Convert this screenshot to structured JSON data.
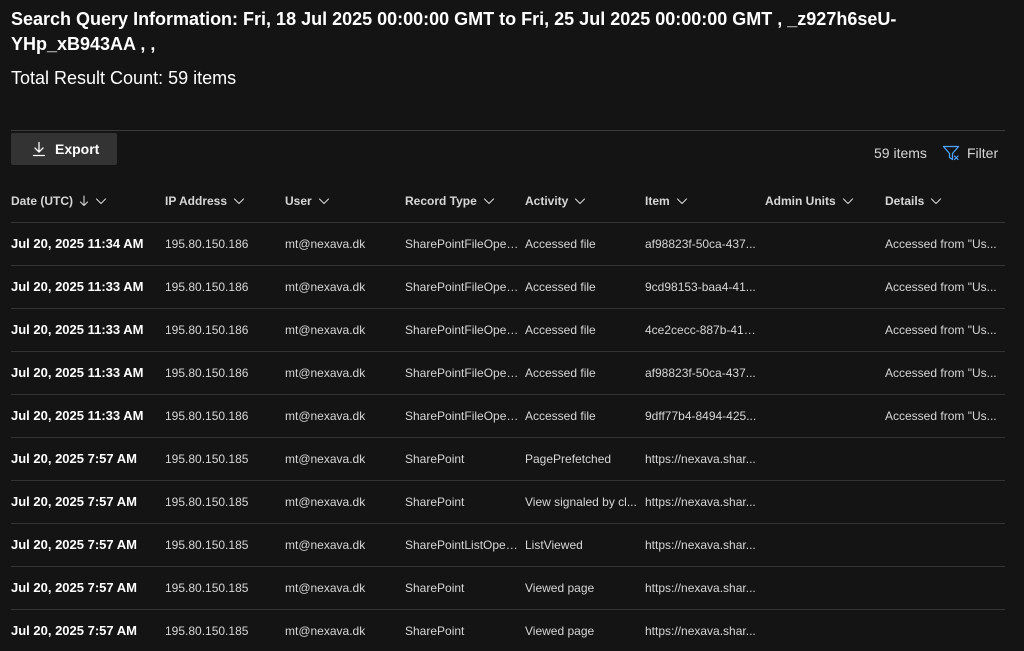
{
  "header": {
    "title": "Search Query Information: Fri, 18 Jul 2025 00:00:00 GMT to Fri, 25 Jul 2025 00:00:00 GMT , _z927h6seU-YHp_xB943AA , ,",
    "total_result": "Total Result Count: 59 items"
  },
  "toolbar": {
    "export_label": "Export",
    "items_count": "59 items",
    "filter_label": "Filter"
  },
  "icons": {
    "export": "download-icon",
    "filter": "filter-icon",
    "sort": "arrow-down-icon",
    "column_menu": "chevron-down-icon"
  },
  "colors": {
    "background": "#141414",
    "accent": "#4da3ff",
    "button_bg": "#333333",
    "divider": "#333333"
  },
  "table": {
    "columns": [
      {
        "key": "date",
        "label": "Date (UTC)",
        "sorted": "descending"
      },
      {
        "key": "ip",
        "label": "IP Address"
      },
      {
        "key": "user",
        "label": "User"
      },
      {
        "key": "record_type",
        "label": "Record Type"
      },
      {
        "key": "activity",
        "label": "Activity"
      },
      {
        "key": "item",
        "label": "Item"
      },
      {
        "key": "admin_units",
        "label": "Admin Units"
      },
      {
        "key": "details",
        "label": "Details"
      }
    ],
    "rows": [
      {
        "date": "Jul 20, 2025 11:34 AM",
        "ip": "195.80.150.186",
        "user": "mt@nexava.dk",
        "record_type": "SharePointFileOper...",
        "activity": "Accessed file",
        "item": "af98823f-50ca-437...",
        "admin_units": "",
        "details": "Accessed from \"Us..."
      },
      {
        "date": "Jul 20, 2025 11:33 AM",
        "ip": "195.80.150.186",
        "user": "mt@nexava.dk",
        "record_type": "SharePointFileOper...",
        "activity": "Accessed file",
        "item": "9cd98153-baa4-41...",
        "admin_units": "",
        "details": "Accessed from \"Us..."
      },
      {
        "date": "Jul 20, 2025 11:33 AM",
        "ip": "195.80.150.186",
        "user": "mt@nexava.dk",
        "record_type": "SharePointFileOper...",
        "activity": "Accessed file",
        "item": "4ce2cecc-887b-414...",
        "admin_units": "",
        "details": "Accessed from \"Us..."
      },
      {
        "date": "Jul 20, 2025 11:33 AM",
        "ip": "195.80.150.186",
        "user": "mt@nexava.dk",
        "record_type": "SharePointFileOper...",
        "activity": "Accessed file",
        "item": "af98823f-50ca-437...",
        "admin_units": "",
        "details": "Accessed from \"Us..."
      },
      {
        "date": "Jul 20, 2025 11:33 AM",
        "ip": "195.80.150.186",
        "user": "mt@nexava.dk",
        "record_type": "SharePointFileOper...",
        "activity": "Accessed file",
        "item": "9dff77b4-8494-425...",
        "admin_units": "",
        "details": "Accessed from \"Us..."
      },
      {
        "date": "Jul 20, 2025 7:57 AM",
        "ip": "195.80.150.185",
        "user": "mt@nexava.dk",
        "record_type": "SharePoint",
        "activity": "PagePrefetched",
        "item": "https://nexava.shar...",
        "admin_units": "",
        "details": ""
      },
      {
        "date": "Jul 20, 2025 7:57 AM",
        "ip": "195.80.150.185",
        "user": "mt@nexava.dk",
        "record_type": "SharePoint",
        "activity": "View signaled by cl...",
        "item": "https://nexava.shar...",
        "admin_units": "",
        "details": ""
      },
      {
        "date": "Jul 20, 2025 7:57 AM",
        "ip": "195.80.150.185",
        "user": "mt@nexava.dk",
        "record_type": "SharePointListOper...",
        "activity": "ListViewed",
        "item": "https://nexava.shar...",
        "admin_units": "",
        "details": ""
      },
      {
        "date": "Jul 20, 2025 7:57 AM",
        "ip": "195.80.150.185",
        "user": "mt@nexava.dk",
        "record_type": "SharePoint",
        "activity": "Viewed page",
        "item": "https://nexava.shar...",
        "admin_units": "",
        "details": ""
      },
      {
        "date": "Jul 20, 2025 7:57 AM",
        "ip": "195.80.150.185",
        "user": "mt@nexava.dk",
        "record_type": "SharePoint",
        "activity": "Viewed page",
        "item": "https://nexava.shar...",
        "admin_units": "",
        "details": ""
      }
    ]
  }
}
